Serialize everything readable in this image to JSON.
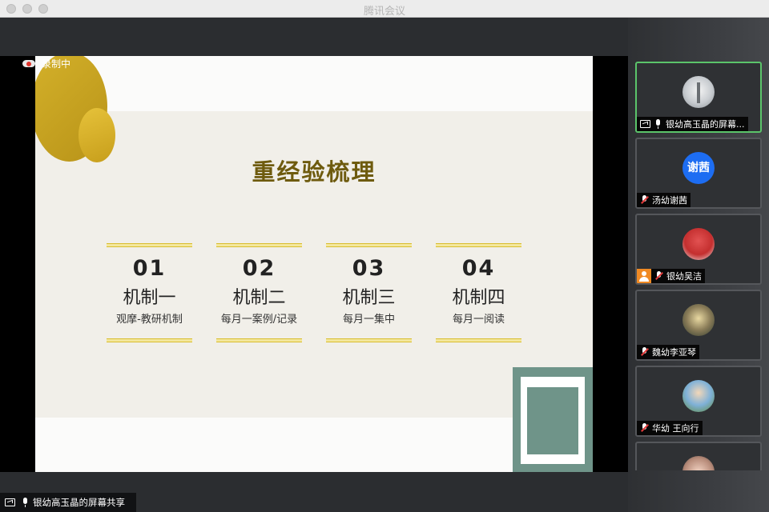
{
  "window": {
    "title": "腾讯会议"
  },
  "recording": {
    "label": "录制中"
  },
  "sharing": {
    "label": "银幼高玉晶的屏幕共享"
  },
  "slide": {
    "title": "重经验梳理",
    "items": [
      {
        "num": "01",
        "title": "机制一",
        "sub": "观摩-教研机制"
      },
      {
        "num": "02",
        "title": "机制二",
        "sub": "每月一案例/记录"
      },
      {
        "num": "03",
        "title": "机制三",
        "sub": "每月一集中"
      },
      {
        "num": "04",
        "title": "机制四",
        "sub": "每月一阅读"
      }
    ]
  },
  "participants": [
    {
      "name": "银幼高玉晶的屏幕...",
      "avatar_icon": "presenter-avatar-photo",
      "sharing": true,
      "mic": "on"
    },
    {
      "name": "汤幼谢茜",
      "avatar_text": "谢茜",
      "mic": "off"
    },
    {
      "name": "银幼吴洁",
      "avatar_icon": "red-hat-avatar-photo",
      "mic": "off",
      "badge": "user-icon"
    },
    {
      "name": "魏幼李亚琴",
      "avatar_icon": "group-avatar-photo",
      "mic": "off"
    },
    {
      "name": "华幼 王向行",
      "avatar_icon": "child-avatar-photo",
      "mic": "off"
    }
  ],
  "colors": {
    "accent_green": "#5bc46a",
    "slide_title": "#6e5b0e",
    "gold": "#d4b12a",
    "teal": "#6f9489",
    "avatar_blue": "#1d6df2",
    "mic_off_red": "#e23b3b"
  }
}
